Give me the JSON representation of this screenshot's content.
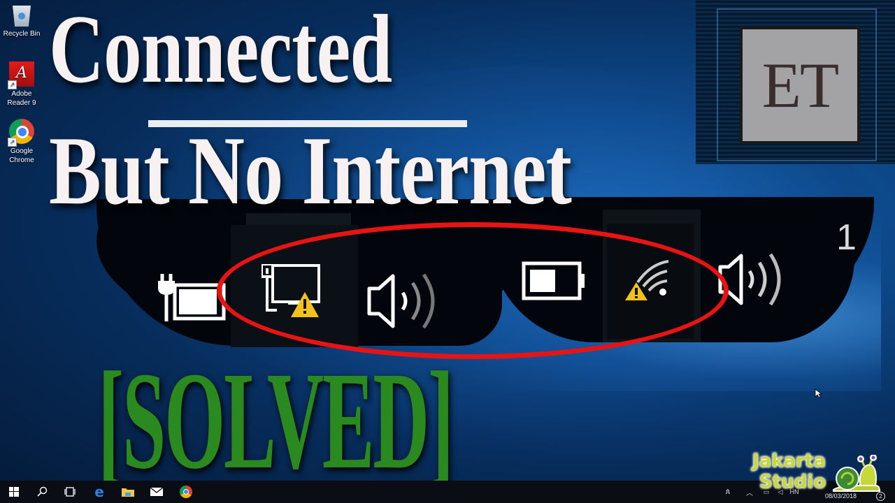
{
  "desktop": {
    "icons": [
      {
        "label": "Recycle Bin",
        "icon": "recycle-bin-icon"
      },
      {
        "label": "Adobe Reader 9",
        "line1": "Adobe",
        "line2": "Reader 9",
        "icon": "adobe-reader-icon"
      },
      {
        "label": "Google Chrome",
        "line1": "Google",
        "line2": "Chrome",
        "icon": "chrome-icon"
      }
    ]
  },
  "headline": {
    "line1": "Connected",
    "line2": "But No Internet",
    "status": "[SOLVED]"
  },
  "colors": {
    "headline": "#f7f1f1",
    "solved": "#2a8a1f",
    "highlight_ellipse": "#e81414",
    "warning": "#f2c21b"
  },
  "tray_zoom": {
    "left_group": [
      "power-plug-battery-icon",
      "ethernet-warning-icon",
      "volume-icon"
    ],
    "right_group": [
      "battery-icon",
      "wifi-warning-icon",
      "volume-icon"
    ],
    "partial_text": "1"
  },
  "logos": {
    "channel_badge": "ET",
    "studio_line1": "Jakarta",
    "studio_line2": "Studio"
  },
  "taskbar": {
    "pinned": [
      "start-icon",
      "search-icon",
      "task-view-icon",
      "edge-icon",
      "file-explorer-icon",
      "mail-icon",
      "chrome-icon"
    ],
    "tray": [
      "people-icon",
      "chevron-up-icon",
      "network-icon",
      "volume-icon",
      "language-icon"
    ],
    "language": "HN",
    "date": "08/03/2018",
    "notifications": "2"
  }
}
